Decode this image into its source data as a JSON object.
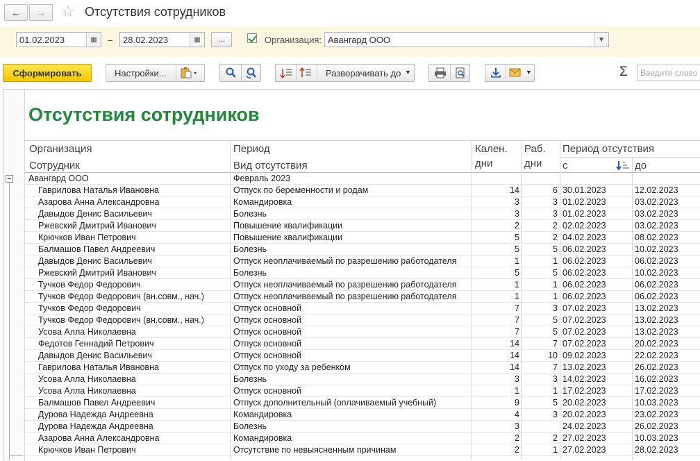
{
  "window": {
    "title": "Отсутствия сотрудников"
  },
  "params": {
    "date_from": "01.02.2023",
    "date_to": "28.02.2023",
    "dash": "–",
    "dots_label": "...",
    "org_checkbox_checked": true,
    "org_label": "Организация:",
    "org_value": "Авангард ООО"
  },
  "toolbar": {
    "generate_label": "Сформировать",
    "settings_label": "Настройки...",
    "expand_label": "Разворачивать до",
    "sigma": "Σ",
    "search_placeholder": "Введите слово"
  },
  "report": {
    "title": "Отсутствия сотрудников",
    "headers": {
      "organization": "Организация",
      "employee": "Сотрудник",
      "period": "Период",
      "absence_type": "Вид отсутствия",
      "cal_days_1": "Кален.",
      "cal_days_2": "дни",
      "work_days_1": "Раб.",
      "work_days_2": "дни",
      "absence_period": "Период отсутствия",
      "from": "с",
      "to": "до"
    },
    "group": {
      "organization": "Авангард ООО",
      "period": "Февраль 2023"
    },
    "rows": [
      {
        "employee": "Гаврилова Наталья Ивановна",
        "type": "Отпуск по беременности и родам",
        "cal": "14",
        "work": "6",
        "from": "30.01.2023",
        "to": "12.02.2023"
      },
      {
        "employee": "Азарова Анна Александровна",
        "type": "Командировка",
        "cal": "3",
        "work": "3",
        "from": "01.02.2023",
        "to": "03.02.2023"
      },
      {
        "employee": "Давыдов Денис Васильевич",
        "type": "Болезнь",
        "cal": "3",
        "work": "3",
        "from": "01.02.2023",
        "to": "03.02.2023"
      },
      {
        "employee": "Ржевский Дмитрий Иванович",
        "type": "Повышение квалификации",
        "cal": "2",
        "work": "2",
        "from": "02.02.2023",
        "to": "03.02.2023"
      },
      {
        "employee": "Крючков Иван Петрович",
        "type": "Повышение квалификации",
        "cal": "5",
        "work": "2",
        "from": "04.02.2023",
        "to": "08.02.2023"
      },
      {
        "employee": "Балмашов Павел Андреевич",
        "type": "Болезнь",
        "cal": "5",
        "work": "5",
        "from": "06.02.2023",
        "to": "10.02.2023"
      },
      {
        "employee": "Давыдов Денис Васильевич",
        "type": "Отпуск неоплачиваемый по разрешению работодателя",
        "cal": "1",
        "work": "1",
        "from": "06.02.2023",
        "to": "06.02.2023"
      },
      {
        "employee": "Ржевский Дмитрий Иванович",
        "type": "Болезнь",
        "cal": "5",
        "work": "5",
        "from": "06.02.2023",
        "to": "10.02.2023"
      },
      {
        "employee": "Тучков Федор Федорович",
        "type": "Отпуск неоплачиваемый по разрешению работодателя",
        "cal": "1",
        "work": "1",
        "from": "06.02.2023",
        "to": "06.02.2023"
      },
      {
        "employee": "Тучков Федор Федорович (вн.совм., нач.)",
        "type": "Отпуск неоплачиваемый по разрешению работодателя",
        "cal": "1",
        "work": "1",
        "from": "06.02.2023",
        "to": "06.02.2023"
      },
      {
        "employee": "Тучков Федор Федорович",
        "type": "Отпуск основной",
        "cal": "7",
        "work": "3",
        "from": "07.02.2023",
        "to": "13.02.2023"
      },
      {
        "employee": "Тучков Федор Федорович (вн.совм., нач.)",
        "type": "Отпуск основной",
        "cal": "7",
        "work": "5",
        "from": "07.02.2023",
        "to": "13.02.2023"
      },
      {
        "employee": "Усова Алла Николаевна",
        "type": "Отпуск основной",
        "cal": "7",
        "work": "5",
        "from": "07.02.2023",
        "to": "13.02.2023"
      },
      {
        "employee": "Федотов Геннадий Петрович",
        "type": "Отпуск основной",
        "cal": "14",
        "work": "7",
        "from": "07.02.2023",
        "to": "20.02.2023"
      },
      {
        "employee": "Давыдов Денис Васильевич",
        "type": "Отпуск основной",
        "cal": "14",
        "work": "10",
        "from": "09.02.2023",
        "to": "22.02.2023"
      },
      {
        "employee": "Гаврилова Наталья Ивановна",
        "type": "Отпуск по уходу за ребенком",
        "cal": "14",
        "work": "7",
        "from": "13.02.2023",
        "to": "26.02.2023"
      },
      {
        "employee": "Усова Алла Николаевна",
        "type": "Болезнь",
        "cal": "3",
        "work": "3",
        "from": "14.02.2023",
        "to": "16.02.2023"
      },
      {
        "employee": "Усова Алла Николаевна",
        "type": "Отпуск основной",
        "cal": "1",
        "work": "1",
        "from": "17.02.2023",
        "to": "17.02.2023"
      },
      {
        "employee": "Балмашов Павел Андреевич",
        "type": "Отпуск дополнительный (оплачиваемый учебный)",
        "cal": "9",
        "work": "5",
        "from": "20.02.2023",
        "to": "10.03.2023"
      },
      {
        "employee": "Дурова Надежда Андреевна",
        "type": "Командировка",
        "cal": "4",
        "work": "3",
        "from": "20.02.2023",
        "to": "23.02.2023"
      },
      {
        "employee": "Дурова Надежда Андреевна",
        "type": "Болезнь",
        "cal": "3",
        "work": "",
        "from": "24.02.2023",
        "to": "26.02.2023"
      },
      {
        "employee": "Азарова Анна Александровна",
        "type": "Командировка",
        "cal": "2",
        "work": "2",
        "from": "27.02.2023",
        "to": "10.03.2023"
      },
      {
        "employee": "Крючков Иван Петрович",
        "type": "Отсутствие по невыясненным причинам",
        "cal": "2",
        "work": "1",
        "from": "27.02.2023",
        "to": "28.02.2023"
      }
    ]
  }
}
